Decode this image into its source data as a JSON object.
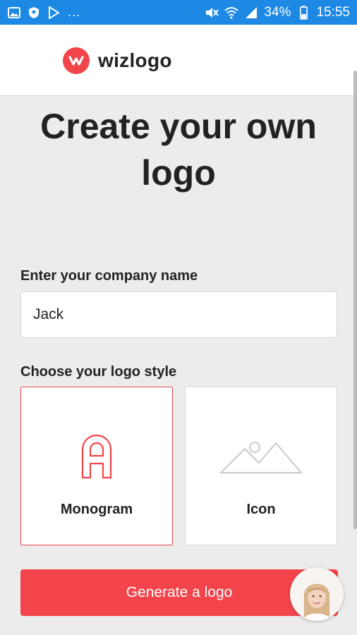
{
  "status_bar": {
    "overflow": "...",
    "battery": "34%",
    "time": "15:55",
    "left_icons": [
      "image-icon",
      "shield-icon",
      "play-icon"
    ],
    "right_icons": [
      "mute-icon",
      "wifi-icon",
      "signal-icon",
      "battery-icon"
    ]
  },
  "header": {
    "brand": "wizlogo"
  },
  "main": {
    "title_line1": "Create your own",
    "title_line2": "logo",
    "company_label": "Enter your company name",
    "company_value": "Jack",
    "style_label": "Choose your logo style",
    "styles": [
      {
        "label": "Monogram",
        "selected": true
      },
      {
        "label": "Icon",
        "selected": false
      }
    ],
    "generate_label": "Generate a logo"
  },
  "colors": {
    "accent": "#f2444a",
    "status_bar": "#1e88e5",
    "background": "#ececec"
  }
}
